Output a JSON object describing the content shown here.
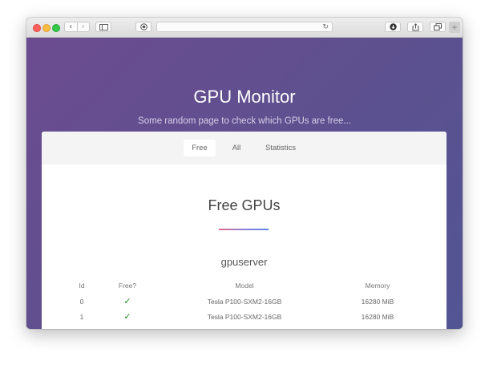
{
  "page": {
    "title": "GPU Monitor",
    "subtitle": "Some random page to check which GPUs are free..."
  },
  "browser": {
    "nav_back": "‹",
    "nav_forward": "›",
    "reload": "↻",
    "new_tab": "+"
  },
  "tabs": [
    {
      "label": "Free",
      "active": true
    },
    {
      "label": "All",
      "active": false
    },
    {
      "label": "Statistics",
      "active": false
    }
  ],
  "section": {
    "heading": "Free GPUs",
    "server": "gpuserver"
  },
  "table": {
    "headers": [
      "Id",
      "Free?",
      "Model",
      "Memory"
    ],
    "rows": [
      {
        "id": "0",
        "free": "✓",
        "model": "Tesla P100-SXM2-16GB",
        "memory": "16280 MiB"
      },
      {
        "id": "1",
        "free": "✓",
        "model": "Tesla P100-SXM2-16GB",
        "memory": "16280 MiB"
      }
    ]
  },
  "colors": {
    "background_gradient": [
      "#6c4c90",
      "#525594"
    ],
    "check": "#1f8e1f",
    "underline_gradient": [
      "#e46a8a",
      "#5f86e8"
    ]
  }
}
